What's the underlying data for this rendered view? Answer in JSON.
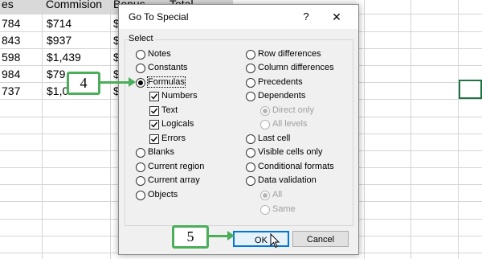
{
  "sheet": {
    "headers": [
      "es",
      "Commision",
      "Bonus",
      "Total"
    ],
    "rows": [
      {
        "a": "784",
        "b": "$714",
        "c": "$7"
      },
      {
        "a": "843",
        "b": "$937",
        "c": "$1"
      },
      {
        "a": "598",
        "b": "$1,439",
        "c": "$2"
      },
      {
        "a": "984",
        "b": "$79",
        "c": "$1"
      },
      {
        "a": "737",
        "b": "$1,0",
        "c": "$1"
      }
    ]
  },
  "dialog": {
    "title": "Go To Special",
    "help": "?",
    "close": "✕",
    "group_label": "Select",
    "left_options": [
      {
        "label": "Notes",
        "type": "radio",
        "checked": false
      },
      {
        "label": "Constants",
        "type": "radio",
        "checked": false
      },
      {
        "label": "Formulas",
        "type": "radio",
        "checked": true
      },
      {
        "label": "Numbers",
        "type": "checkbox",
        "checked": true
      },
      {
        "label": "Text",
        "type": "checkbox",
        "checked": true
      },
      {
        "label": "Logicals",
        "type": "checkbox",
        "checked": true
      },
      {
        "label": "Errors",
        "type": "checkbox",
        "checked": true
      },
      {
        "label": "Blanks",
        "type": "radio",
        "checked": false
      },
      {
        "label": "Current region",
        "type": "radio",
        "checked": false
      },
      {
        "label": "Current array",
        "type": "radio",
        "checked": false
      },
      {
        "label": "Objects",
        "type": "radio",
        "checked": false
      }
    ],
    "right_options": [
      {
        "label": "Row differences",
        "type": "radio",
        "checked": false
      },
      {
        "label": "Column differences",
        "type": "radio",
        "checked": false
      },
      {
        "label": "Precedents",
        "type": "radio",
        "checked": false
      },
      {
        "label": "Dependents",
        "type": "radio",
        "checked": false
      },
      {
        "label": "Direct only",
        "type": "radio",
        "checked": true,
        "disabled": true
      },
      {
        "label": "All levels",
        "type": "radio",
        "checked": false,
        "disabled": true
      },
      {
        "label": "Last cell",
        "type": "radio",
        "checked": false
      },
      {
        "label": "Visible cells only",
        "type": "radio",
        "checked": false
      },
      {
        "label": "Conditional formats",
        "type": "radio",
        "checked": false
      },
      {
        "label": "Data validation",
        "type": "radio",
        "checked": false
      },
      {
        "label": "All",
        "type": "radio",
        "checked": true,
        "disabled": true
      },
      {
        "label": "Same",
        "type": "radio",
        "checked": false,
        "disabled": true
      }
    ],
    "ok_label": "OK",
    "cancel_label": "Cancel"
  },
  "callouts": {
    "step4": "4",
    "step5": "5"
  },
  "colors": {
    "callout_border": "#4cae5b",
    "excel_green": "#217346",
    "ok_border": "#0078d7"
  }
}
